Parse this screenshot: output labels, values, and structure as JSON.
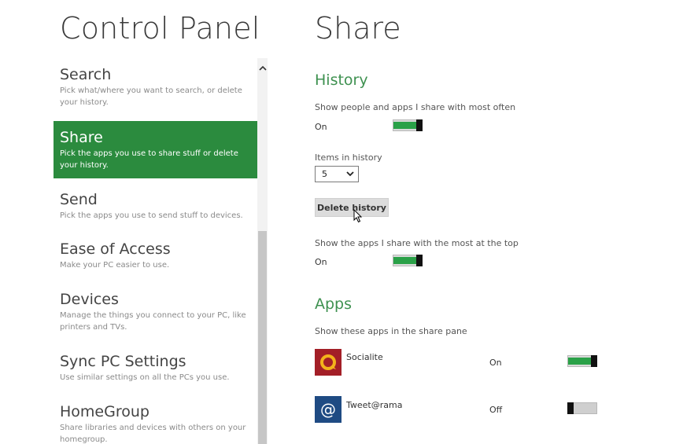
{
  "left_panel": {
    "title": "Control Panel",
    "items": [
      {
        "name": "Search",
        "description": "Pick what/where you want to search, or delete your history.",
        "active": false
      },
      {
        "name": "Share",
        "description": "Pick the apps you use to share stuff or delete your history.",
        "active": true
      },
      {
        "name": "Send",
        "description": "Pick the apps you use to send stuff to devices.",
        "active": false
      },
      {
        "name": "Ease of Access",
        "description": "Make your PC easier to use.",
        "active": false
      },
      {
        "name": "Devices",
        "description": "Manage the things you connect to your PC, like printers and TVs.",
        "active": false
      },
      {
        "name": "Sync PC Settings",
        "description": "Use similar settings on all the PCs you use.",
        "active": false
      },
      {
        "name": "HomeGroup",
        "description": "Share libraries and devices with others on your homegroup.",
        "active": false
      }
    ]
  },
  "right_panel": {
    "title": "Share",
    "history": {
      "heading": "History",
      "show_people": {
        "label": "Show people and apps I share with most often",
        "state": "On"
      },
      "items_in_history": {
        "label": "Items in history",
        "value": "5"
      },
      "delete_button": "Delete history",
      "show_top": {
        "label": "Show the apps I share with the most at the top",
        "state": "On"
      }
    },
    "apps": {
      "heading": "Apps",
      "label": "Show these apps in the share pane",
      "items": [
        {
          "name": "Socialite",
          "state": "On",
          "icon": "socialite-icon",
          "tile_color": "#a31f27"
        },
        {
          "name": "Tweet@rama",
          "state": "Off",
          "icon": "tweetrama-icon",
          "tile_color": "#1f4b83"
        }
      ]
    }
  },
  "colors": {
    "accent": "#2b8b3e",
    "heading_green": "#3e9150",
    "toggle_on": "#2aa148"
  }
}
